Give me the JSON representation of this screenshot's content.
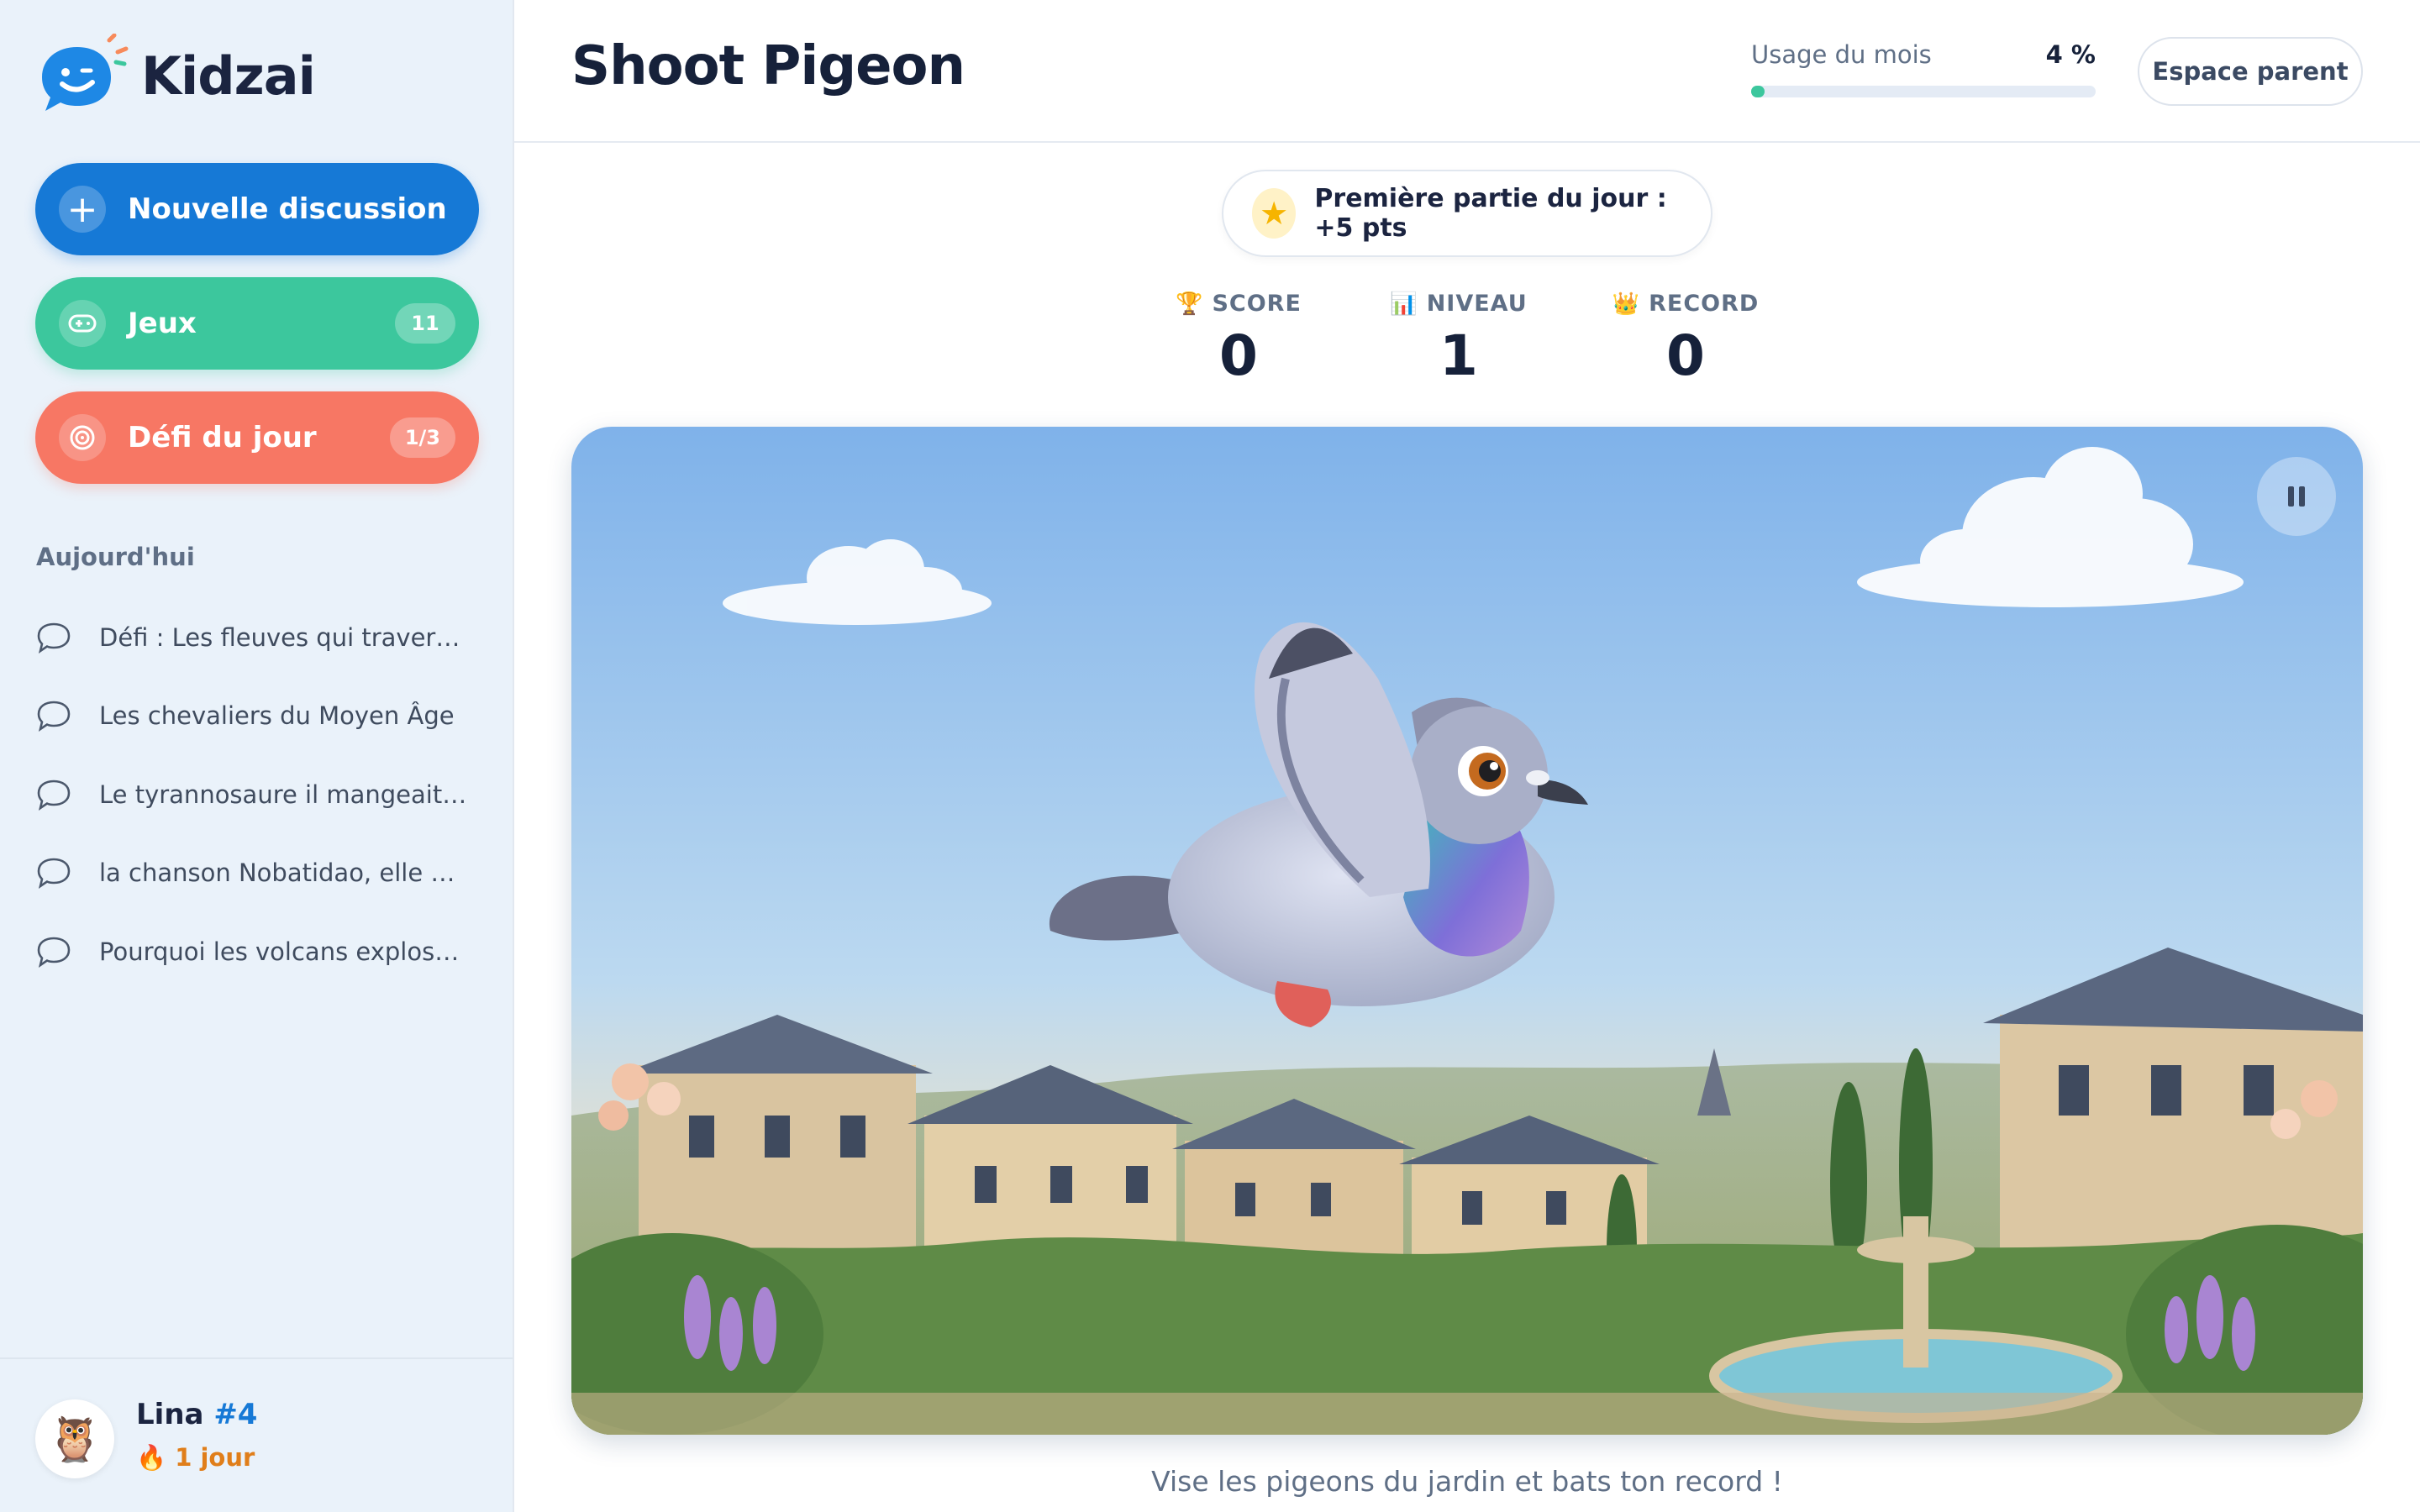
{
  "app": {
    "name": "Kidzai"
  },
  "sidebar": {
    "new_chat_label": "Nouvelle discussion",
    "games": {
      "label": "Jeux",
      "count": "11"
    },
    "daily_challenge": {
      "label": "Défi du jour",
      "progress": "1/3"
    },
    "section_title": "Aujourd'hui",
    "conversations": [
      {
        "title": "Défi : Les fleuves qui traversent..."
      },
      {
        "title": "Les chevaliers du Moyen Âge"
      },
      {
        "title": "Le tyrannosaure il mangeait qu..."
      },
      {
        "title": "la chanson Nobatidao, elle est e..."
      },
      {
        "title": "Pourquoi les volcans explosent ?"
      }
    ],
    "user": {
      "name": "Lina",
      "rank": "#4",
      "streak": "1 jour",
      "avatar_icon": "owl-icon"
    }
  },
  "header": {
    "title": "Shoot Pigeon",
    "usage": {
      "label": "Usage du mois",
      "value_text": "4 %",
      "percent": 4
    },
    "parent_button": "Espace parent"
  },
  "bonus": {
    "text": "Première partie du jour : +5 pts",
    "icon": "star-icon"
  },
  "stats": {
    "score": {
      "label": "SCORE",
      "value": "0",
      "icon": "trophy-icon"
    },
    "level": {
      "label": "NIVEAU",
      "value": "1",
      "icon": "chart-icon"
    },
    "record": {
      "label": "RECORD",
      "value": "0",
      "icon": "crown-icon"
    }
  },
  "game": {
    "scene": "pigeon flying over a French garden village",
    "pause_icon": "pause-icon"
  },
  "caption": "Vise les pigeons du jardin et bats ton record !",
  "colors": {
    "primary": "#1679d6",
    "games": "#3cc79d",
    "challenge": "#f77764",
    "sidebar_bg": "#eaf2fa"
  }
}
